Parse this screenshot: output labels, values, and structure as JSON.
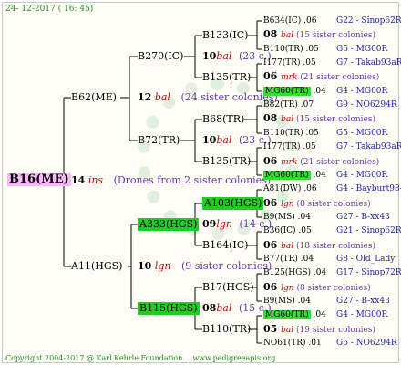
{
  "header": {
    "date": "24- 12-2017 ( 16: 45)"
  },
  "footer": {
    "copyright": "Copyright 2004-2017 @ Karl Kehrle Foundation.",
    "url": "www.pedigreeapis.org"
  },
  "root": {
    "label": "B16(ME)"
  },
  "gen1": {
    "num": "14",
    "ins": "ins",
    "note": "(Drones from 2 sister colonies)",
    "father": "B62(ME)",
    "mother": "A11(HGS)"
  },
  "gen2": {
    "upper": {
      "num": "12",
      "ins": "bal",
      "note": "(24 sister colonies)"
    },
    "lower": {
      "num": "10",
      "ins": "lgn",
      "note": "(9 sister colonies)"
    },
    "b270": "B270(IC)",
    "b72": "B72(TR)",
    "a333": "A333(HGS)",
    "b115": "B115(HGS)"
  },
  "gen3": {
    "n1": "10",
    "i1": "bal",
    "c1": "(23 c.)",
    "n2": "10",
    "i2": "bal",
    "c2": "(23 c.)",
    "n3": "09",
    "i3": "lgn",
    "c3": "(14 c.)",
    "n4": "08",
    "i4": "bal",
    "c4": "(15 c.)",
    "b133": "B133(IC)",
    "b135a": "B135(TR)",
    "b68": "B68(TR)",
    "b135b": "B135(TR)",
    "a103": "A103(HGS)",
    "b164": "B164(IC)",
    "b17": "B17(HGS)",
    "b110": "B110(TR)"
  },
  "leaves": [
    {
      "name": "B634(IC)",
      "v": ".06",
      "right": "G22 - Sinop62R"
    },
    {
      "num": "08",
      "ins": "bal",
      "note": "(15 sister colonies)"
    },
    {
      "name": "B110(TR)",
      "v": ".05",
      "right": "G5 - MG00R"
    },
    {
      "name": "I177(TR)",
      "v": ".05",
      "right": "G7 - Takab93aR"
    },
    {
      "num": "06",
      "ins": "mrk",
      "note": "(21 sister colonies)"
    },
    {
      "name": "MG60(TR)",
      "v": ".04",
      "right": "G4 - MG00R",
      "hl": true
    },
    {
      "name": "B82(TR)",
      "v": ".07",
      "right": "G9 - NO6294R"
    },
    {
      "num": "08",
      "ins": "bal",
      "note": "(15 sister colonies)"
    },
    {
      "name": "B110(TR)",
      "v": ".05",
      "right": "G5 - MG00R"
    },
    {
      "name": "I177(TR)",
      "v": ".05",
      "right": "G7 - Takab93aR"
    },
    {
      "num": "06",
      "ins": "mrk",
      "note": "(21 sister colonies)"
    },
    {
      "name": "MG60(TR)",
      "v": ".04",
      "right": "G4 - MG00R",
      "hl": true
    },
    {
      "name": "A81(DW)",
      "v": ".06",
      "right": "G4 - Bayburt98-3"
    },
    {
      "num": "06",
      "ins": "lgn",
      "note": "(8 sister colonies)"
    },
    {
      "name": "B9(MS)",
      "v": ".04",
      "right": "G27 - B-xx43"
    },
    {
      "name": "B36(IC)",
      "v": ".05",
      "right": "G21 - Sinop62R"
    },
    {
      "num": "06",
      "ins": "bal",
      "note": "(18 sister colonies)"
    },
    {
      "name": "B77(TR)",
      "v": ".04",
      "right": "G8 - Old_Lady"
    },
    {
      "name": "B125(HGS)",
      "v": ".04",
      "right": "G17 - Sinop72R"
    },
    {
      "num": "06",
      "ins": "lgn",
      "note": "(8 sister colonies)"
    },
    {
      "name": "B9(MS)",
      "v": ".04",
      "right": "G27 - B-xx43"
    },
    {
      "name": "MG60(TR)",
      "v": ".04",
      "right": "G4 - MG00R",
      "hl": true
    },
    {
      "num": "05",
      "ins": "bal",
      "note": "(19 sister colonies)"
    },
    {
      "name": "NO61(TR)",
      "v": ".01",
      "right": "G6 - NO6294R"
    }
  ]
}
